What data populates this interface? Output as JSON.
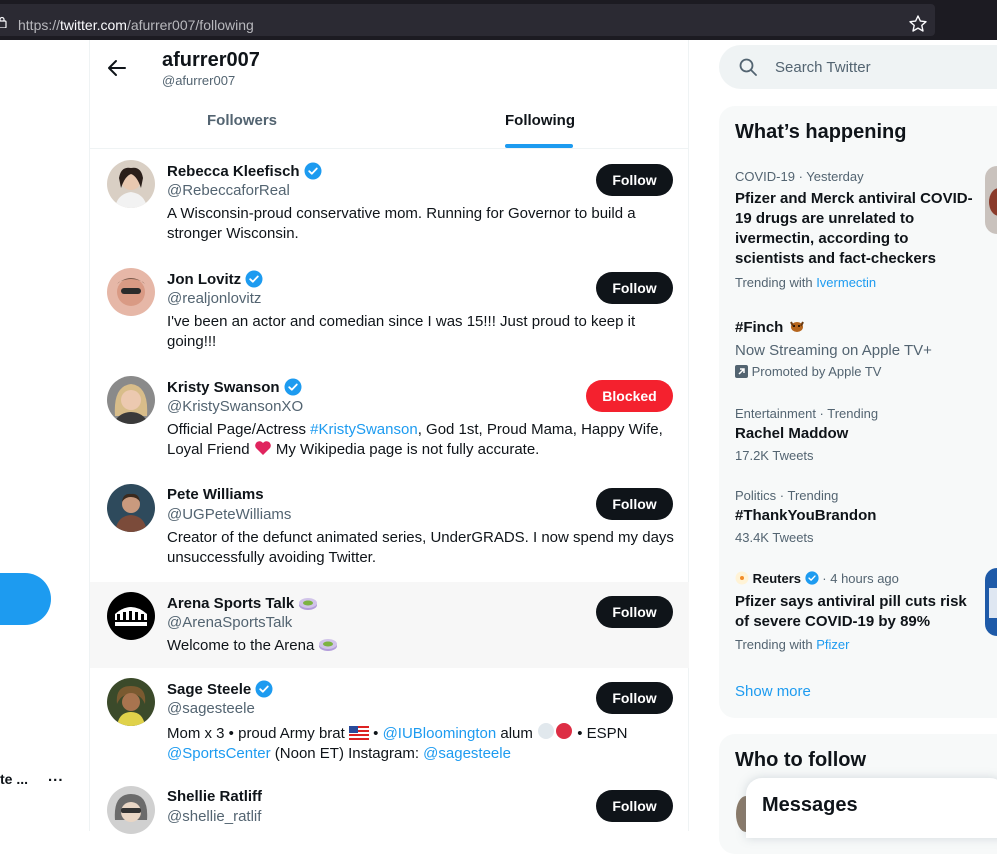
{
  "browser": {
    "url_prefix": "https://",
    "url_domain": "twitter.com",
    "url_path": "/afurrer007/following"
  },
  "sidebar": {
    "account_name": "te ...",
    "more": "..."
  },
  "profile": {
    "name": "afurrer007",
    "handle": "@afurrer007",
    "tabs": [
      {
        "label": "Followers",
        "active": false
      },
      {
        "label": "Following",
        "active": true
      }
    ]
  },
  "following": [
    {
      "name": "Rebecca Kleefisch",
      "handle": "@RebeccaforReal",
      "verified": true,
      "bio": "A Wisconsin-proud conservative mom. Running for Governor to build a stronger Wisconsin.",
      "button": "Follow"
    },
    {
      "name": "Jon Lovitz",
      "handle": "@realjonlovitz",
      "verified": true,
      "bio": "I've been an actor and comedian since I was 15!!! Just proud to keep it going!!!",
      "button": "Follow"
    },
    {
      "name": "Kristy Swanson",
      "handle": "@KristySwansonXO",
      "verified": true,
      "bio_pre": "Official Page/Actress ",
      "bio_link": "#KristySwanson",
      "bio_mid": ", God 1st, Proud Mama, Happy Wife, Loyal Friend ",
      "bio_post": " My Wikipedia page is not fully accurate.",
      "button": "Blocked"
    },
    {
      "name": "Pete Williams",
      "handle": "@UGPeteWilliams",
      "verified": false,
      "bio": "Creator of the defunct animated series, UnderGRADS. I now spend my days unsuccessfully avoiding Twitter.",
      "button": "Follow"
    },
    {
      "name": "Arena Sports Talk",
      "handle": "@ArenaSportsTalk",
      "verified": false,
      "bio": "Welcome to the Arena",
      "button": "Follow"
    },
    {
      "name": "Sage Steele",
      "handle": "@sagesteele",
      "verified": true,
      "bio_pre": "Mom x 3 • proud Army brat ",
      "bio_link1": "@IUBloomington",
      "bio_mid": " alum ",
      "bio_mid2": " • ESPN",
      "bio_link2": "@SportsCenter",
      "bio_mid3": " (Noon ET) Instagram: ",
      "bio_link3": "@sagesteele",
      "button": "Follow"
    },
    {
      "name": "Shellie Ratliff",
      "handle": "@shellie_ratlif",
      "verified": false,
      "button": "Follow"
    }
  ],
  "search": {
    "placeholder": "Search Twitter"
  },
  "trends": {
    "title": "What’s happening",
    "items": [
      {
        "meta": "COVID-19 · Yesterday",
        "title": "Pfizer and Merck antiviral COVID-19 drugs are unrelated to ivermectin, according to scientists and fact-checkers",
        "trending_label": "Trending with",
        "trending_link": "Ivermectin"
      },
      {
        "title": "#Finch",
        "subtitle": "Now Streaming on Apple TV+",
        "promoted": "Promoted by Apple TV"
      },
      {
        "meta": "Entertainment · Trending",
        "title": "Rachel Maddow",
        "count": "17.2K Tweets"
      },
      {
        "meta": "Politics · Trending",
        "title": "#ThankYouBrandon",
        "count": "43.4K Tweets"
      },
      {
        "source": "Reuters",
        "time": " · 4 hours ago",
        "title": "Pfizer says antiviral pill cuts risk of severe COVID-19 by 89%",
        "trending_label": "Trending with",
        "trending_link": "Pfizer"
      }
    ],
    "show_more": "Show more"
  },
  "who_to_follow": {
    "title": "Who to follow"
  },
  "messages": {
    "title": "Messages"
  },
  "colors": {
    "accent": "#1d9bf0",
    "text": "#0f1419",
    "secondary": "#536471",
    "blocked": "#f4212e"
  }
}
